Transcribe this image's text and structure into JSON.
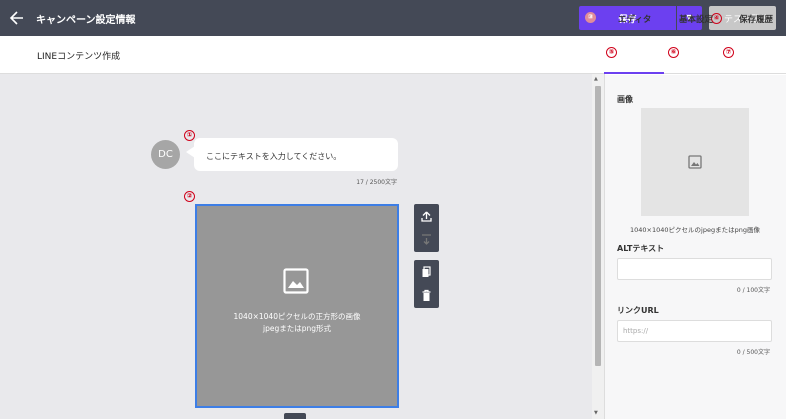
{
  "header": {
    "title": "キャンペーン設定情報",
    "save_label": "保存",
    "save_num": "③",
    "dropdown_icon": "▼",
    "test_num": "④",
    "test_label": "テスト配信"
  },
  "content": {
    "title": "LINEコンテンツ作成"
  },
  "message": {
    "num": "①",
    "avatar": "DC",
    "text": "ここにテキストを入力してください。",
    "count": "17 / 2500文字"
  },
  "image_block": {
    "num": "②",
    "line1": "1040×1040ピクセルの正方形の画像",
    "line2": "jpegまたはpng形式"
  },
  "panel": {
    "tabs": [
      {
        "num": "⑤",
        "label": "エディタ"
      },
      {
        "num": "⑥",
        "label": "基本設定"
      },
      {
        "num": "⑦",
        "label": "保存履歴"
      }
    ],
    "image_label": "画像",
    "image_caption": "1040×1040ピクセルのjpegまたはpng画像",
    "alt_label": "ALTテキスト",
    "alt_count": "0 / 100文字",
    "link_label": "リンクURL",
    "link_placeholder": "https://",
    "link_count": "0 / 500文字"
  },
  "colors": {
    "header_bg": "#444956",
    "accent": "#6c40f0",
    "selection": "#3d7ee6"
  }
}
